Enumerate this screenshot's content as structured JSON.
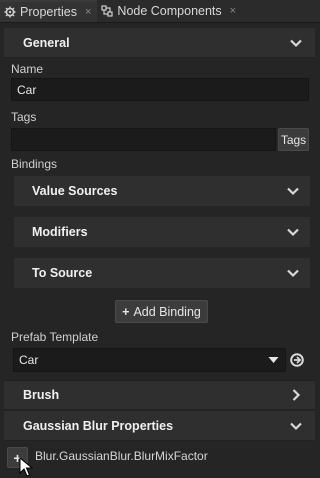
{
  "tabs": [
    {
      "label": "Properties",
      "active": true
    },
    {
      "label": "Node Components",
      "active": false
    }
  ],
  "tab_close_glyph": "×",
  "sections": {
    "general": {
      "title": "General"
    },
    "name": {
      "label": "Name",
      "value": "Car"
    },
    "tags": {
      "label": "Tags",
      "value": "",
      "button": "Tags"
    },
    "bindings": {
      "label": "Bindings",
      "groups": [
        "Value Sources",
        "Modifiers",
        "To Source"
      ],
      "add_button": "Add Binding",
      "add_glyph": "+"
    },
    "prefab": {
      "label": "Prefab Template",
      "value": "Car"
    },
    "brush": {
      "title": "Brush"
    },
    "blur": {
      "title": "Gaussian Blur Properties"
    },
    "blur_item": {
      "label": "Blur.GaussianBlur.BlurMixFactor",
      "button_glyph": "+"
    }
  },
  "icons": {
    "properties_tab": "gear-icon",
    "components_tab": "components-icon",
    "expanded": "chevron-down-icon",
    "collapsed": "chevron-right-icon",
    "revert": "revert-icon",
    "cursor": "mouse-pointer-icon"
  },
  "colors": {
    "background": "#252526",
    "panel": "#2f2f30",
    "field": "#1b1b1c",
    "text": "#d4d4d4"
  }
}
